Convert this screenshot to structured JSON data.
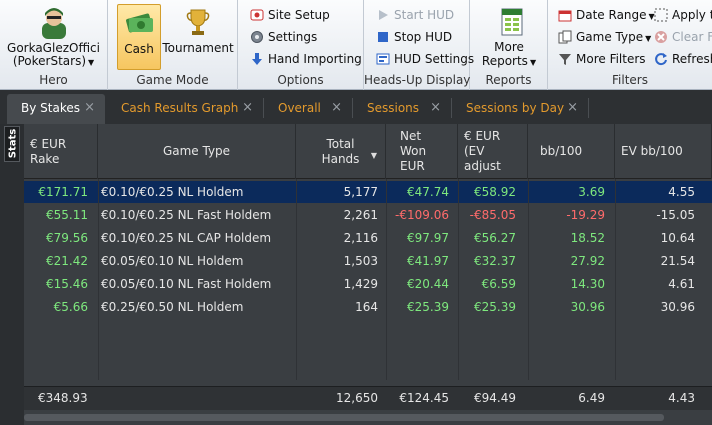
{
  "ribbon": {
    "hero": {
      "name": "GorkaGlezOffici",
      "site": "(PokerStars)",
      "label": "Hero"
    },
    "game_mode": {
      "cash": "Cash",
      "tournament": "Tournament",
      "label": "Game Mode"
    },
    "options": {
      "site_setup": "Site Setup",
      "settings": "Settings",
      "hand_importing": "Hand Importing",
      "label": "Options"
    },
    "hud": {
      "start_hud": "Start HUD",
      "stop_hud": "Stop HUD",
      "hud_settings": "HUD Settings",
      "label": "Heads-Up Display"
    },
    "reports": {
      "more_reports_line1": "More",
      "more_reports_line2": "Reports",
      "label": "Reports"
    },
    "filters": {
      "date_range": "Date Range",
      "game_type": "Game Type",
      "more_filters": "More Filters",
      "apply_to": "Apply to",
      "clear_filters": "Clear Fi",
      "refresh": "Refresh",
      "label": "Filters"
    }
  },
  "tabs": [
    {
      "label": "By Stakes",
      "active": true
    },
    {
      "label": "Cash Results Graph"
    },
    {
      "label": "Overall"
    },
    {
      "label": "Sessions"
    },
    {
      "label": "Sessions by Day"
    }
  ],
  "side_tab": "Stats",
  "columns": [
    {
      "line1": "€ EUR",
      "line2": "Rake"
    },
    {
      "line1": "Game Type"
    },
    {
      "line1": "Total",
      "line2": "Hands"
    },
    {
      "line1": "Net",
      "line2": "Won",
      "line3": "EUR"
    },
    {
      "line1": "€ EUR",
      "line2": "(EV",
      "line3": "adjust"
    },
    {
      "line1": "bb/100"
    },
    {
      "line1": "EV bb/100"
    }
  ],
  "rows": [
    {
      "rake": "€171.71",
      "game": "€0.10/€0.25 NL Holdem",
      "hands": "5,177",
      "net": "€47.74",
      "ev": "€58.92",
      "bb": "3.69",
      "evbb": "4.55"
    },
    {
      "rake": "€55.11",
      "game": "€0.10/€0.25 NL Fast Holdem",
      "hands": "2,261",
      "net": "-€109.06",
      "ev": "-€85.05",
      "bb": "-19.29",
      "evbb": "-15.05"
    },
    {
      "rake": "€79.56",
      "game": "€0.10/€0.25 NL CAP Holdem",
      "hands": "2,116",
      "net": "€97.97",
      "ev": "€56.27",
      "bb": "18.52",
      "evbb": "10.64"
    },
    {
      "rake": "€21.42",
      "game": "€0.05/€0.10 NL Holdem",
      "hands": "1,503",
      "net": "€41.97",
      "ev": "€32.37",
      "bb": "27.92",
      "evbb": "21.54"
    },
    {
      "rake": "€15.46",
      "game": "€0.05/€0.10 NL Fast Holdem",
      "hands": "1,429",
      "net": "€20.44",
      "ev": "€6.59",
      "bb": "14.30",
      "evbb": "4.61"
    },
    {
      "rake": "€5.66",
      "game": "€0.25/€0.50 NL Holdem",
      "hands": "164",
      "net": "€25.39",
      "ev": "€25.39",
      "bb": "30.96",
      "evbb": "30.96"
    }
  ],
  "totals": {
    "rake": "€348.93",
    "hands": "12,650",
    "net": "€124.45",
    "ev": "€94.49",
    "bb": "6.49",
    "evbb": "4.43"
  },
  "colors": {
    "positive": "#7ee87e",
    "negative": "#ff6b6b",
    "selected_row": "#0b2a5b",
    "tab_accent": "#e39a2d"
  }
}
